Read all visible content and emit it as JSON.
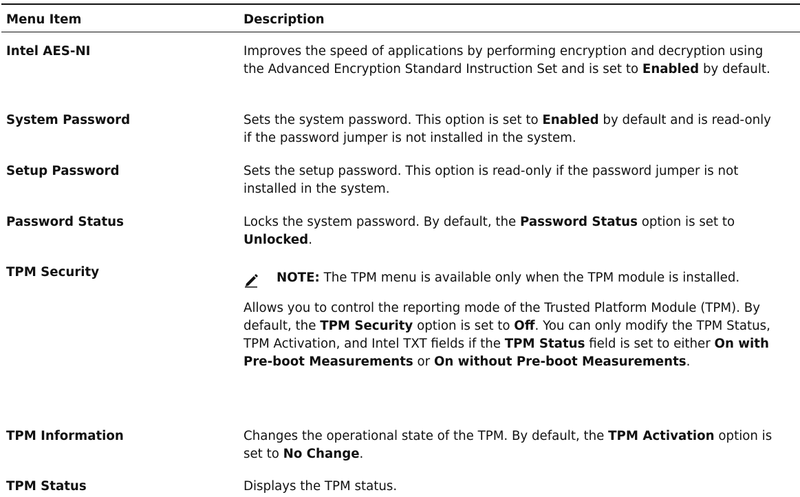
{
  "table": {
    "header": {
      "menu_item": "Menu Item",
      "description": "Description"
    },
    "rows": [
      {
        "item": "Intel AES-NI",
        "desc": {
          "t1": "Improves the speed of applications by performing encryption and decryption using the Advanced Encryption Standard Instruction Set and is set to ",
          "b1": "Enabled",
          "t2": " by default."
        }
      },
      {
        "item": "System Password",
        "desc": {
          "t1": "Sets the system password. This option is set to ",
          "b1": "Enabled",
          "t2": " by default and is read-only if the password jumper is not installed in the system."
        }
      },
      {
        "item": "Setup Password",
        "desc": {
          "t1": "Sets the setup password. This option is read-only if the password jumper is not installed in the system."
        }
      },
      {
        "item": "Password Status",
        "desc": {
          "t1": "Locks the system password. By default, the ",
          "b1": "Password Status",
          "t2": " option is set to ",
          "b2": "Unlocked",
          "t3": "."
        }
      },
      {
        "item": "TPM Security",
        "note": {
          "icon": "pencil-note-icon",
          "label": "NOTE:",
          "text": " The TPM menu is available only when the TPM module is installed."
        },
        "desc": {
          "t1": "Allows you to control the reporting mode of the Trusted Platform Module (TPM). By default, the ",
          "b1": "TPM Security",
          "t2": " option is set to ",
          "b2": "Off",
          "t3": ". You can only modify the TPM Status, TPM Activation, and Intel TXT fields if the ",
          "b3": "TPM Status",
          "t4": " field is set to either ",
          "b4": "On with Pre-boot Measurements",
          "t5": " or ",
          "b5": "On without Pre-boot Measurements",
          "t6": "."
        }
      },
      {
        "item": "TPM Information",
        "desc": {
          "t1": "Changes the operational state of the TPM. By default, the ",
          "b1": "TPM Activation",
          "t2": " option is set to ",
          "b2": "No Change",
          "t3": "."
        }
      },
      {
        "item": "TPM Status",
        "desc": {
          "t1": "Displays the TPM status."
        }
      }
    ]
  }
}
